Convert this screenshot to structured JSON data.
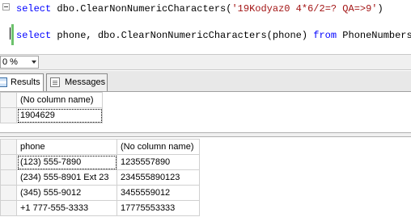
{
  "editor": {
    "line1": {
      "kw": "select",
      "mid": " dbo.ClearNonNumericCharacters(",
      "str": "'19Kodyaz0 4*6/2=? QA=>9'",
      "end": ")"
    },
    "line2": {
      "kw1": "select",
      "mid1": " phone, dbo.ClearNonNumericCharacters(phone) ",
      "kw2": "from",
      "end": " PhoneNumbers"
    }
  },
  "zoom": {
    "value": "0 %"
  },
  "tabs": {
    "results": "Results",
    "messages": "Messages"
  },
  "grid1": {
    "headers": [
      "(No column name)"
    ],
    "rows": [
      [
        "1904629"
      ]
    ]
  },
  "grid2": {
    "headers": [
      "phone",
      "(No column name)"
    ],
    "rows": [
      [
        "(123) 555-7890",
        "1235557890"
      ],
      [
        "(234) 555-8901 Ext 23",
        "234555890123"
      ],
      [
        "(345) 555-9012",
        "3455559012"
      ],
      [
        "+1 777-555-3333",
        "17775553333"
      ]
    ]
  }
}
